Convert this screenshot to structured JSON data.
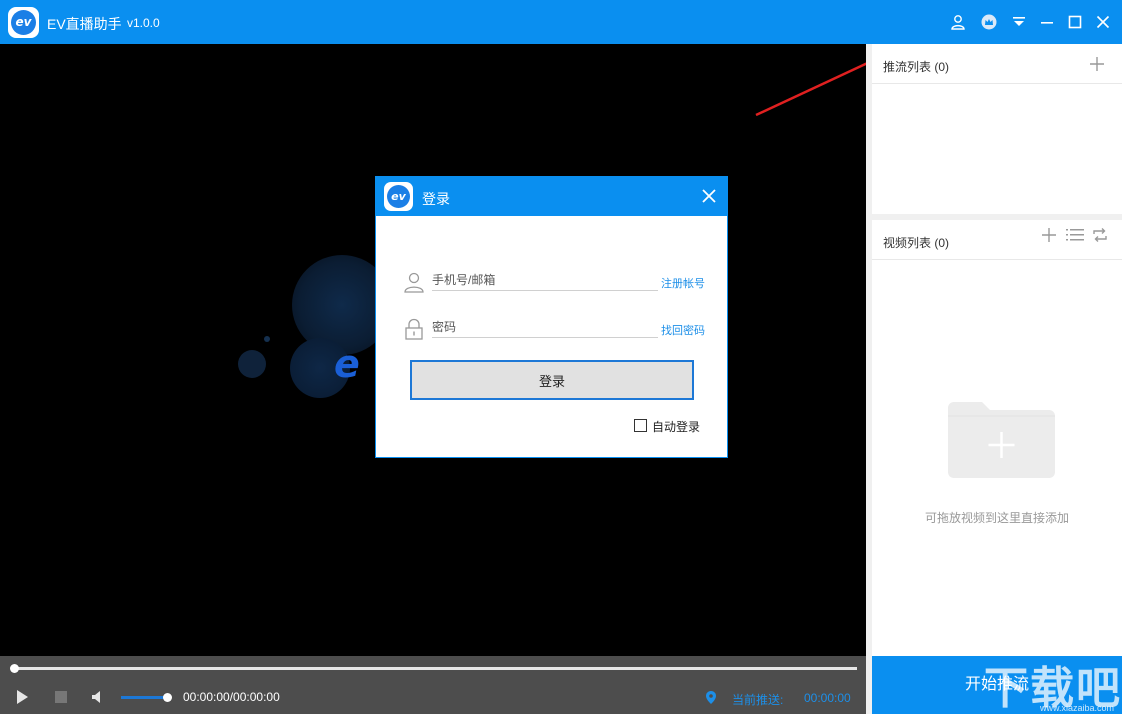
{
  "app": {
    "title": "EV直播助手",
    "version": "v1.0.0",
    "logo_text": "ev"
  },
  "titlebar_icons": [
    "user-icon",
    "crown-icon",
    "dropdown-icon",
    "minimize-icon",
    "maximize-icon",
    "close-icon"
  ],
  "player": {
    "time": "00:00:00/00:00:00",
    "current_push_label": "当前推送:",
    "current_push_time": "00:00:00",
    "progress": 0,
    "volume": 0.95
  },
  "sidebar": {
    "push_list": {
      "title": "推流列表 (0)"
    },
    "video_list": {
      "title": "视频列表 (0)"
    },
    "empty_hint": "可拖放视频到这里直接添加",
    "start_button": "开始推流"
  },
  "login_dialog": {
    "title": "登录",
    "logo_text": "ev",
    "phone_placeholder": "手机号/邮箱",
    "password_placeholder": "密码",
    "register_link": "注册帐号",
    "forgot_link": "找回密码",
    "login_button": "登录",
    "auto_login": "自动登录",
    "auto_login_checked": false
  },
  "watermark": {
    "text": "下载吧",
    "sub": "www.xiazaiba.com"
  },
  "colors": {
    "brand": "#0a8ff0",
    "link": "#1d8fe8",
    "arrow": "#e02020"
  }
}
